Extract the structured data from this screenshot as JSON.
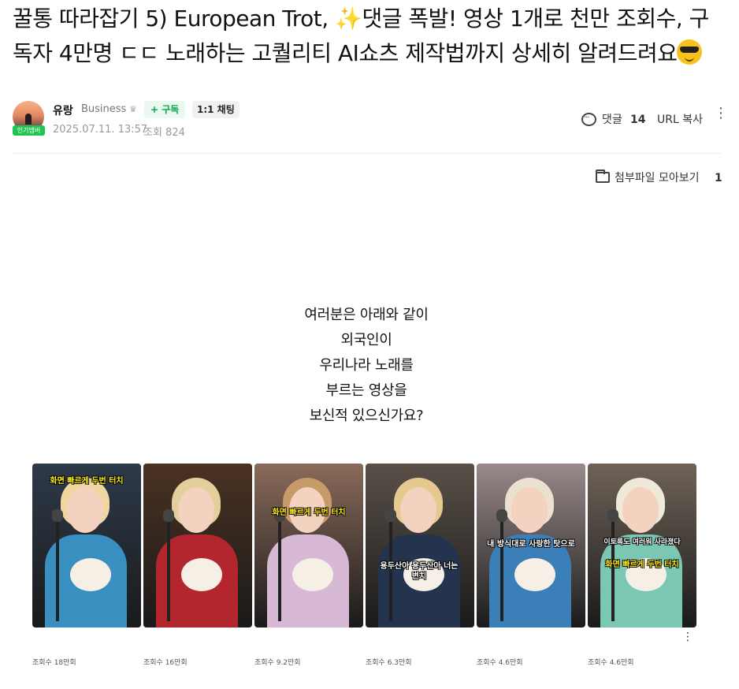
{
  "post": {
    "title_a": "꿀통 따라잡기 5) European Trot, ",
    "title_b": "댓글 폭발! 영상 1개로 천만 조회수, 구독자 4만명 ㄷㄷ 노래하는 고퀄리티 AI쇼츠 제작법까지 상세히 알려드려요",
    "sparkle_emoji": "✨",
    "title_end_icon": "sunglasses-face-emoji"
  },
  "author": {
    "badge": "인기멤버",
    "name": "유랑",
    "tag": "Business",
    "crown": "♛",
    "subscribe_label": "+ 구독",
    "chat_label": "1:1 채팅",
    "date": "2025.07.11. 13:57",
    "views": "조회 824"
  },
  "actions": {
    "comment_label": "댓글",
    "comment_count": "14",
    "url_copy_label": "URL 복사",
    "more": "⋮"
  },
  "attachments": {
    "label": "첨부파일 모아보기",
    "count": "1"
  },
  "intro": {
    "lines": [
      "여러분은 아래와 같이",
      "외국인이",
      "우리나라 노래를",
      "부르는 영상을",
      "보신적 있으신가요?"
    ]
  },
  "thumbnails": [
    {
      "caption": "화면 빠르게 두번 터치",
      "caption2": "",
      "views": "조회수 18만회",
      "colors": {
        "bg": "#2d3a4a",
        "hair": "#f0d7a2",
        "body": "#3a8fc1"
      }
    },
    {
      "caption": "",
      "caption2": "",
      "views": "조회수 16만회",
      "colors": {
        "bg": "#4a3222",
        "hair": "#e3cf9b",
        "body": "#b3262e"
      }
    },
    {
      "caption": "화면 빠르게 두번 터치",
      "caption2": "",
      "views": "조회수 9.2만회",
      "colors": {
        "bg": "#8a6a5a",
        "hair": "#c79a6a",
        "body": "#d7b9d6"
      }
    },
    {
      "caption": "",
      "caption2": "용두산아 용두산아 너는 변치",
      "views": "조회수 6.3만회",
      "colors": {
        "bg": "#5a5048",
        "hair": "#e6c98e",
        "body": "#24344f"
      }
    },
    {
      "caption": "",
      "caption2": "내 방식대로 사랑한 탓으로",
      "views": "조회수 4.6만회",
      "colors": {
        "bg": "#9a8a8a",
        "hair": "#ece1cf",
        "body": "#3a7fb8"
      }
    },
    {
      "caption": "화면 빠르게 두번 터치",
      "caption2": "이토록도 여러워 사라졌다",
      "views": "조회수 4.6만회",
      "colors": {
        "bg": "#6f6358",
        "hair": "#efe9da",
        "body": "#7cc7b4"
      }
    }
  ],
  "thumbs_more": "⋮"
}
